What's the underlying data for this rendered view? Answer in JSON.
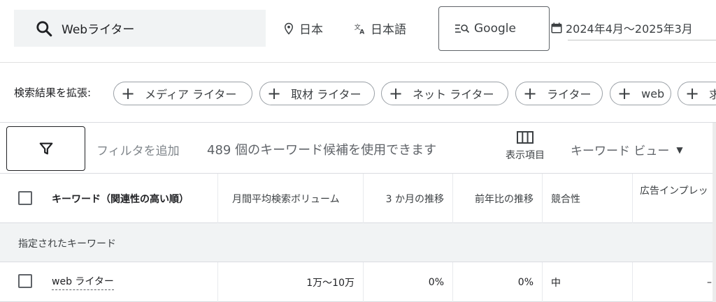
{
  "search": {
    "query": "Webライター"
  },
  "location": {
    "label": "日本"
  },
  "language": {
    "label": "日本語"
  },
  "network": {
    "label": "Google"
  },
  "date_range": {
    "label": "2024年4月～2025年3月"
  },
  "expand": {
    "label": "検索結果を拡張:",
    "chips": [
      "メディア ライター",
      "取材 ライター",
      "ネット ライター",
      "ライター",
      "web",
      "求"
    ]
  },
  "toolbar": {
    "add_filter": "フィルタを追加",
    "candidates": "489 個のキーワード候補を使用できます",
    "columns_label": "表示項目",
    "view_label": "キーワード ビュー"
  },
  "table": {
    "headers": [
      "キーワード（関連性の高い順）",
      "月間平均検索ボリューム",
      "3 か月の推移",
      "前年比の推移",
      "競合性",
      "広告インプレッ"
    ],
    "group_label": "指定されたキーワード",
    "rows": [
      {
        "keyword": "web ライター",
        "volume": "1万～10万",
        "three_month": "0%",
        "yoy": "0%",
        "competition": "中",
        "impression": "–"
      }
    ]
  }
}
